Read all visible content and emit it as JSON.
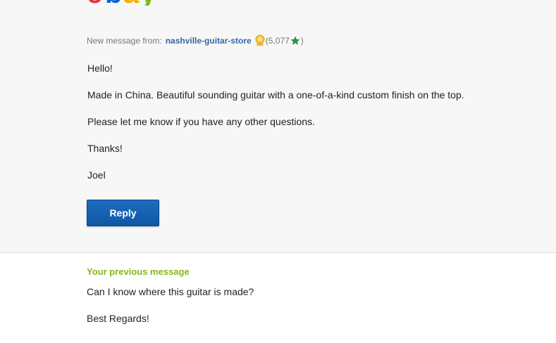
{
  "logo": {
    "letters": [
      "e",
      "b",
      "a",
      "y"
    ],
    "colors": [
      "#e53238",
      "#0064d2",
      "#f5af02",
      "#86b817"
    ]
  },
  "message": {
    "header_prefix": "New message from:",
    "sender": "nashville-guitar-store",
    "feedback_open": "(5,077",
    "feedback_close": ")",
    "body": [
      "Hello!",
      "Made in China. Beautiful sounding guitar with a one-of-a-kind custom finish on the top.",
      "Please let me know if you have any other questions.",
      "Thanks!",
      "Joel"
    ],
    "reply_label": "Reply"
  },
  "previous": {
    "title": "Your previous message",
    "body": [
      "Can I know where this guitar is made?",
      "Best Regards!"
    ]
  },
  "colors": {
    "panel_bg": "#f7f7f7",
    "sender_link": "#3665a8",
    "reply_button": "#1565b8",
    "previous_title": "#86b817"
  }
}
